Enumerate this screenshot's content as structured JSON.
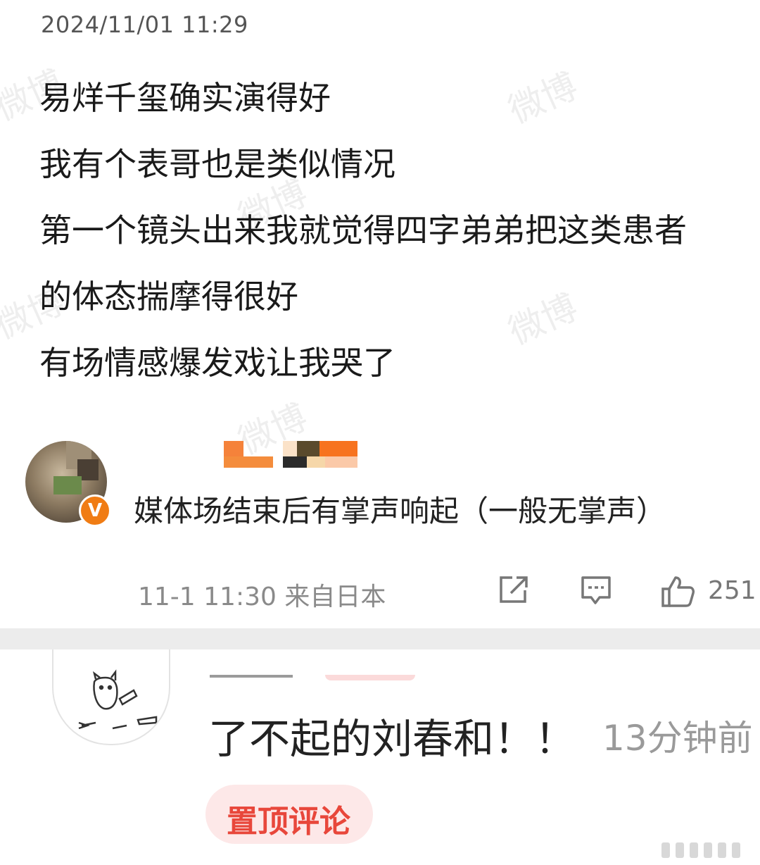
{
  "post": {
    "timestamp": "2024/11/01 11:29",
    "lines": [
      "易烊千玺确实演得好",
      "我有个表哥也是类似情况",
      "第一个镜头出来我就觉得四字弟弟把这类患者",
      "的体态揣摩得很好",
      "有场情感爆发戏让我哭了"
    ],
    "watermark": "微博"
  },
  "author": {
    "verified_badge": "V",
    "quote": "媒体场结束后有掌声响起（一般无掌声）"
  },
  "meta": {
    "time_source": "11-1 11:30  来自日本",
    "like_count": "251",
    "icons": [
      "share-icon",
      "comment-icon",
      "like-icon"
    ]
  },
  "comment": {
    "text": "了不起的刘春和！！",
    "time": "13分钟前",
    "badge": "置顶评论"
  },
  "colors": {
    "verified": "#f07c14",
    "pin_text": "#e8473b",
    "pin_bg": "#fde8e8",
    "divider": "#ececec"
  }
}
